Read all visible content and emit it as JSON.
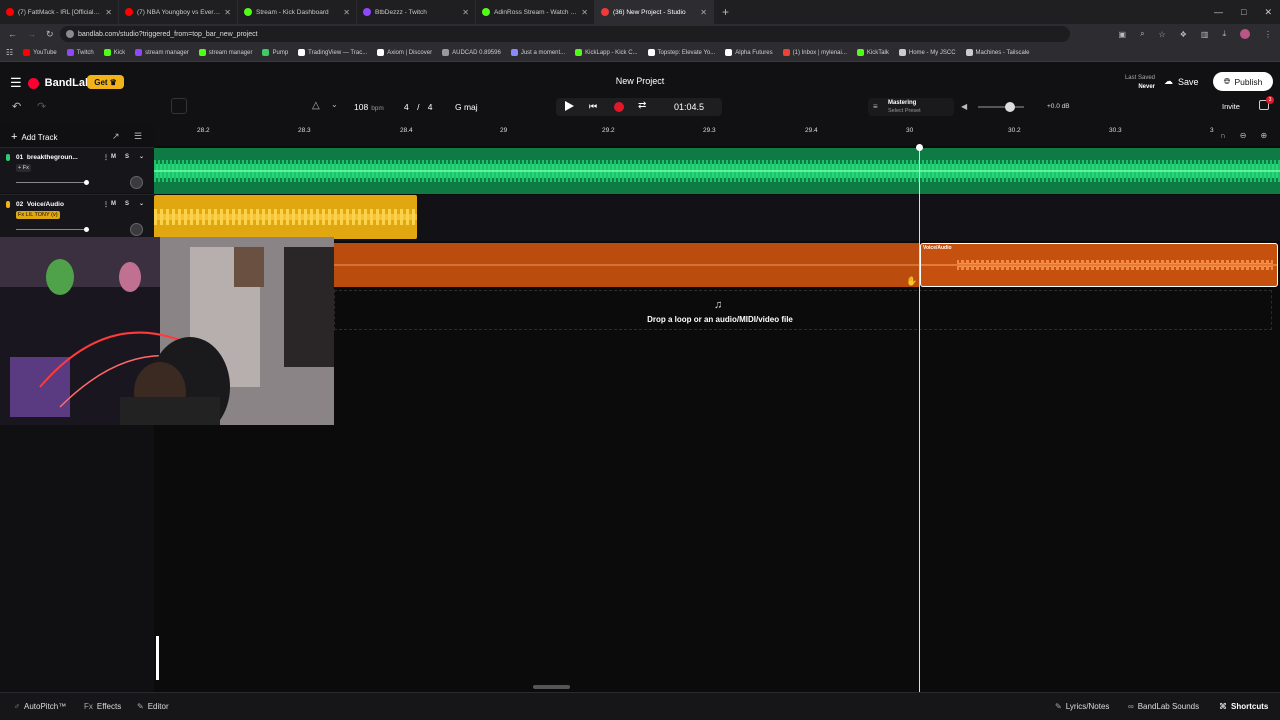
{
  "browser": {
    "tabs": [
      {
        "label": "(7) FattMack - IRL [Official Mu...",
        "color": "#ff0000"
      },
      {
        "label": "(7) NBA Youngboy vs Everybo...",
        "color": "#ff0000"
      },
      {
        "label": "Stream - Kick Dashboard",
        "color": "#53fc18"
      },
      {
        "label": "BtbDezzz - Twitch",
        "color": "#9146ff"
      },
      {
        "label": "AdinRoss Stream - Watch Live ...",
        "color": "#53fc18"
      },
      {
        "label": "(36) New Project - Studio",
        "color": "#f03a3a"
      }
    ],
    "new_tab": "+",
    "url": "bandlab.com/studio?triggered_from=top_bar_new_project",
    "bookmarks": [
      {
        "label": "YouTube",
        "color": "#ff0000"
      },
      {
        "label": "Twitch",
        "color": "#9146ff"
      },
      {
        "label": "Kick",
        "color": "#53fc18"
      },
      {
        "label": "stream manager",
        "color": "#9146ff"
      },
      {
        "label": "stream manager",
        "color": "#53fc18"
      },
      {
        "label": "Pump",
        "color": "#3ec96b"
      },
      {
        "label": "TradingView — Trac...",
        "color": "#ffffff"
      },
      {
        "label": "Axiom | Discover",
        "color": "#ffffff"
      },
      {
        "label": "AUDCAD 0.89596",
        "color": "#999999"
      },
      {
        "label": "Just a moment...",
        "color": "#8888ff"
      },
      {
        "label": "KickLapp - Kick C...",
        "color": "#53fc18"
      },
      {
        "label": "Topstep: Elevate Yo...",
        "color": "#ffffff"
      },
      {
        "label": "Alpha Futures",
        "color": "#ffffff"
      },
      {
        "label": "(1) Inbox | mylenai...",
        "color": "#ea4335"
      },
      {
        "label": "KickTalk",
        "color": "#53fc18"
      },
      {
        "label": "Home - My JSCC",
        "color": "#cccccc"
      },
      {
        "label": "Machines - Tailscale",
        "color": "#cccccc"
      }
    ]
  },
  "app": {
    "brand": "BandLab",
    "get_label": "Get",
    "project_title": "New Project",
    "last_saved_label": "Last Saved",
    "last_saved_value": "Never",
    "save_label": "Save",
    "publish_label": "Publish",
    "invite_label": "Invite",
    "gift_badge": "3"
  },
  "transport": {
    "bpm": "108",
    "bpm_unit": "bpm",
    "time_sig": "4 / 4",
    "key": "G maj",
    "time": "01:04.5",
    "mastering_title": "Mastering",
    "mastering_sub": "Select Preset",
    "volume_db": "+0.0 dB",
    "volume_level": 0.7
  },
  "tracks": {
    "add_label": "Add Track",
    "items": [
      {
        "num": "01",
        "name": "breakthegroun...",
        "fx": "+ Fx",
        "fader": 0.9,
        "color": "#2ecc71"
      },
      {
        "num": "02",
        "name": "Voice/Audio",
        "fx": "Fx LIL TONY (v)",
        "fader": 0.9,
        "color": "#f2b31a"
      }
    ],
    "mute": "M",
    "solo": "S"
  },
  "ruler": {
    "ticks": [
      "28.2",
      "28.3",
      "28.4",
      "29",
      "29.2",
      "29.3",
      "29.4",
      "30",
      "30.2",
      "30.3",
      "3"
    ]
  },
  "clips": {
    "recording_label": "Voice/Audio"
  },
  "dropzone": {
    "text": "Drop a loop or an audio/MIDI/video file"
  },
  "footer": {
    "autopitch": "AutoPitch™",
    "effects": "Effects",
    "editor": "Editor",
    "lyrics": "Lyrics/Notes",
    "sounds": "BandLab Sounds",
    "shortcuts": "Shortcuts"
  },
  "colors": {
    "accent": "#f03a3a",
    "track1": "#0e7a44",
    "track2": "#e0a711",
    "record": "#c9530f"
  }
}
